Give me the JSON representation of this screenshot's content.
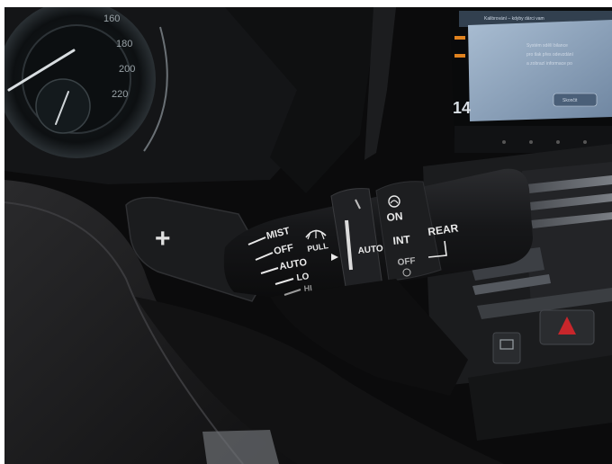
{
  "speedometer": {
    "ticks": [
      "160",
      "180",
      "200",
      "220"
    ]
  },
  "infotainment": {
    "header_text": "Kalibrování – kdyby dárci vam",
    "body_lines": [
      "Systém sdělí bilance",
      "pro tlak přes odevzdání",
      "a zobrazí informace po"
    ],
    "button_label": "Skončit",
    "side_number": "14"
  },
  "paddle": {
    "symbol": "+"
  },
  "stalk": {
    "mist": "MIST",
    "off": "OFF",
    "auto": "AUTO",
    "lo": "LO",
    "hi": "HI",
    "pull": "PULL",
    "ring_auto": "AUTO",
    "on": "ON",
    "int": "INT",
    "rear_off": "OFF",
    "rear": "REAR"
  },
  "colors": {
    "background": "#0b0b0c",
    "stalk": "#1a1b1d",
    "label": "#e9e9e9",
    "screen": "#8fa6bf",
    "hazard": "#c8262b"
  }
}
